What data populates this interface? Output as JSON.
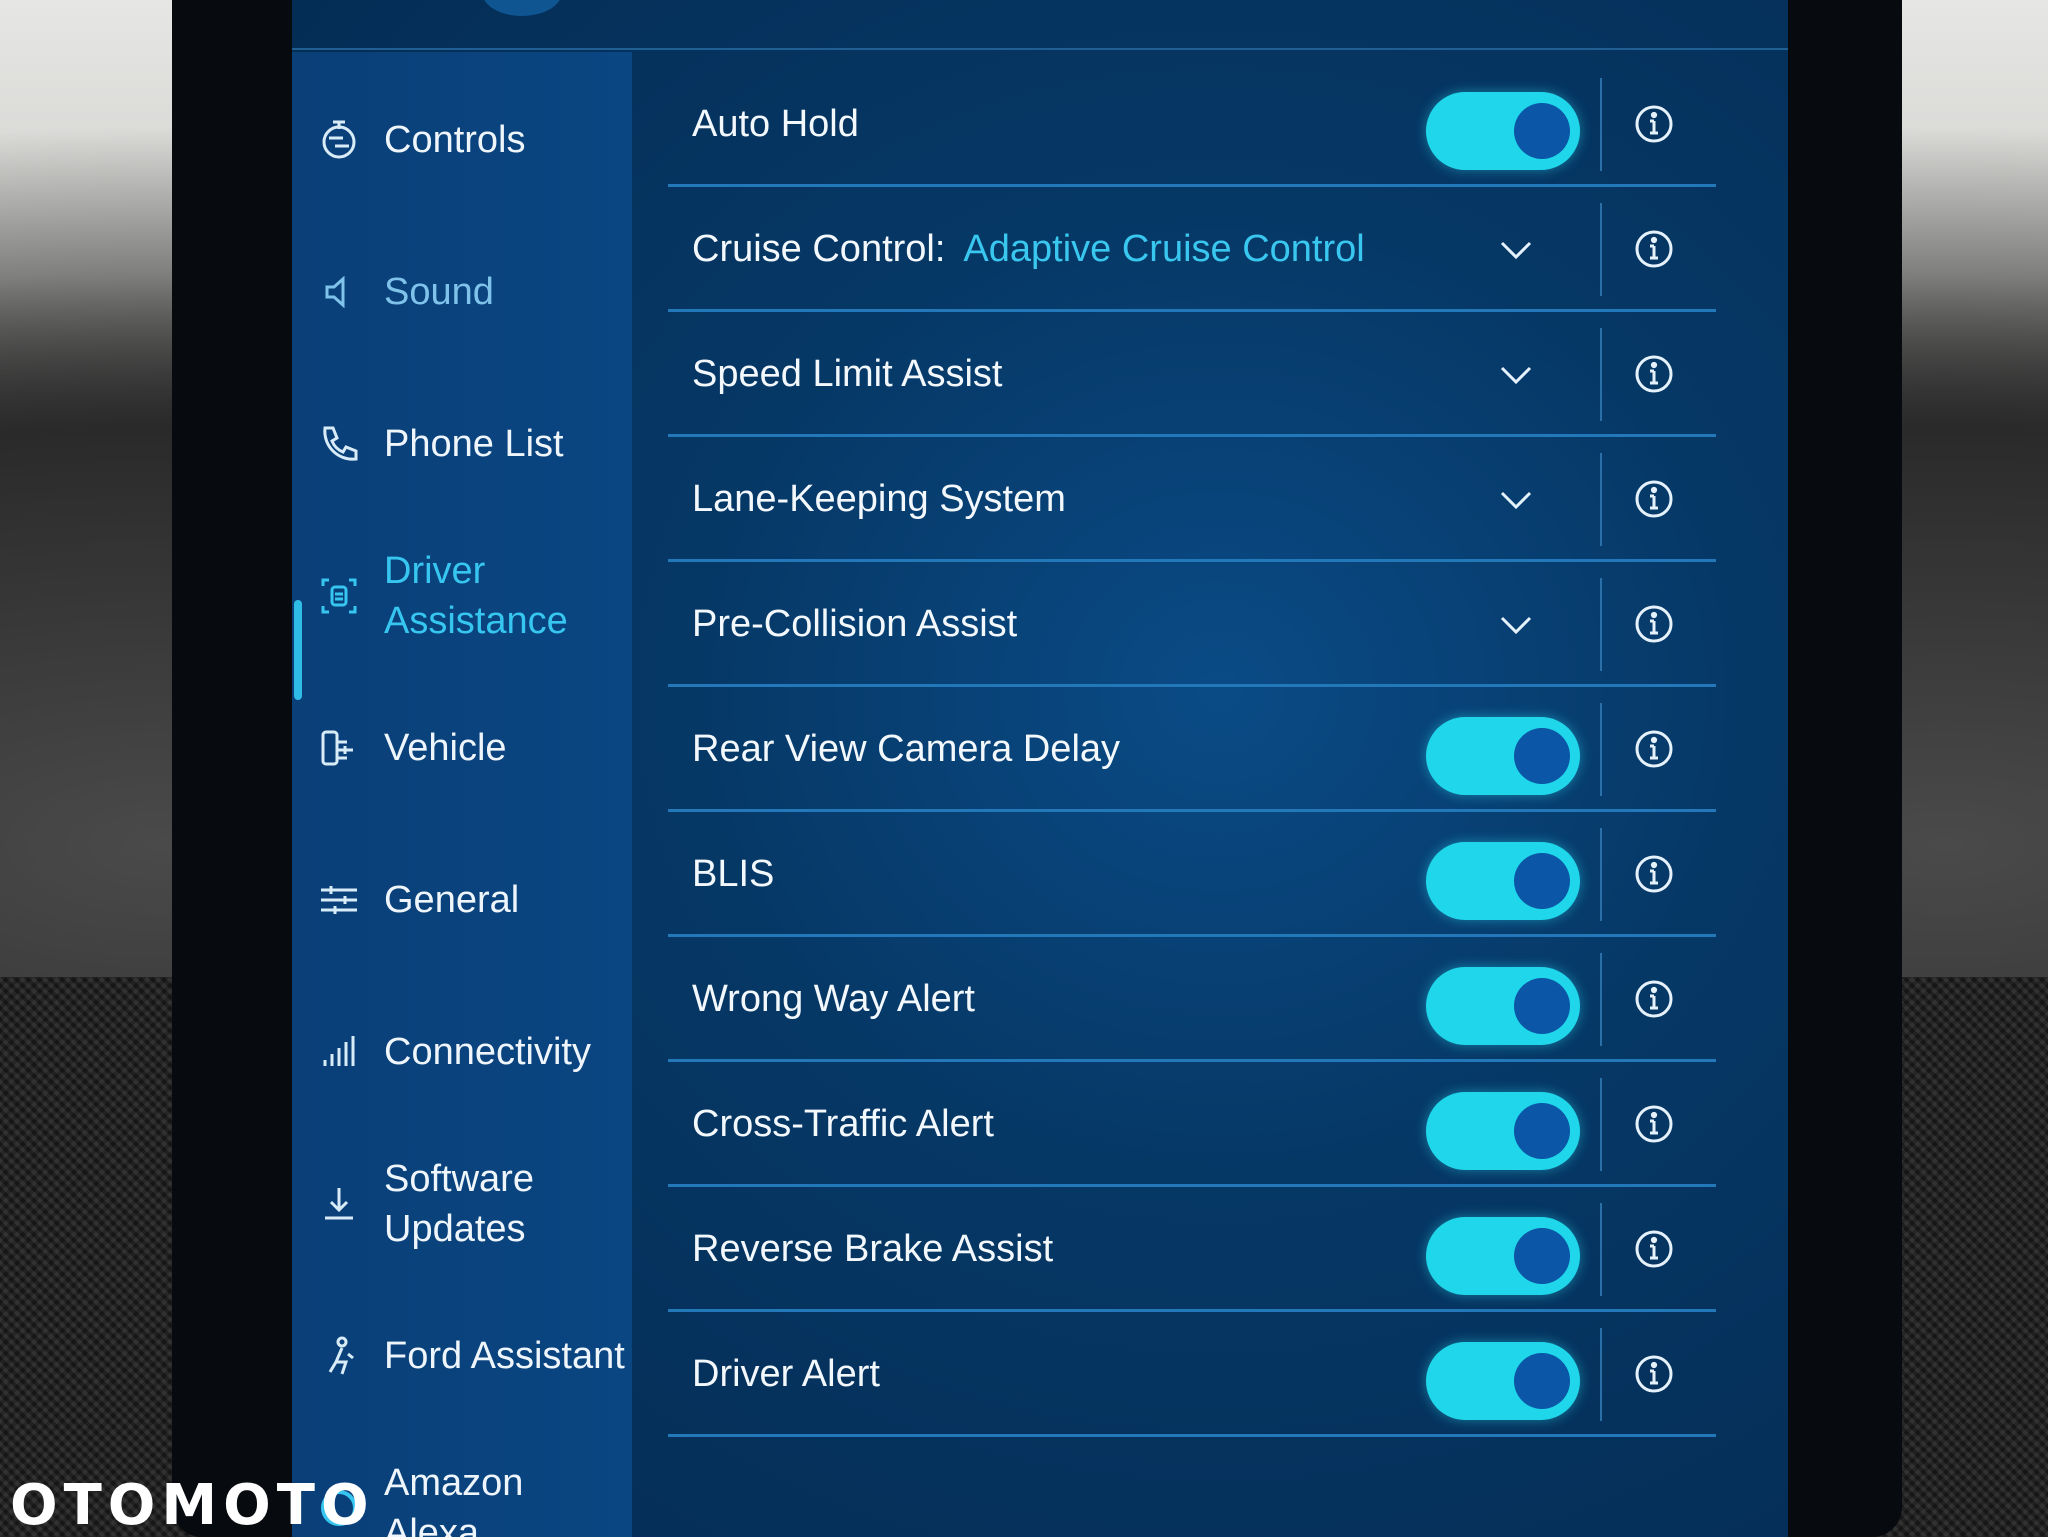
{
  "colors": {
    "screen_bg": "#063866",
    "accent": "#36c6f0",
    "toggle_on": "#1fd6ea",
    "knob": "#0b56a6",
    "divider": "#2278b8"
  },
  "sidebar": {
    "items": [
      {
        "label": "Controls",
        "icon": "controls-icon",
        "state": "normal"
      },
      {
        "label": "Sound",
        "icon": "speaker-icon",
        "state": "dim"
      },
      {
        "label": "Phone List",
        "icon": "phone-icon",
        "state": "normal"
      },
      {
        "label": "Driver Assistance",
        "icon": "driver-assist-icon",
        "state": "active"
      },
      {
        "label": "Vehicle",
        "icon": "vehicle-icon",
        "state": "normal"
      },
      {
        "label": "General",
        "icon": "sliders-icon",
        "state": "normal"
      },
      {
        "label": "Connectivity",
        "icon": "signal-bars-icon",
        "state": "normal"
      },
      {
        "label": "Software Updates",
        "icon": "download-icon",
        "state": "normal"
      },
      {
        "label": "Ford Assistant",
        "icon": "assistant-icon",
        "state": "normal"
      },
      {
        "label": "Amazon Alexa",
        "icon": "alexa-icon",
        "state": "normal"
      }
    ]
  },
  "settings": {
    "rows": [
      {
        "label": "Auto Hold",
        "control": "toggle",
        "on": true
      },
      {
        "label": "Cruise Control:",
        "value": "Adaptive Cruise Control",
        "control": "dropdown"
      },
      {
        "label": "Speed Limit Assist",
        "control": "dropdown"
      },
      {
        "label": "Lane-Keeping System",
        "control": "dropdown"
      },
      {
        "label": "Pre-Collision Assist",
        "control": "dropdown"
      },
      {
        "label": "Rear View Camera Delay",
        "control": "toggle",
        "on": true
      },
      {
        "label": "BLIS",
        "control": "toggle",
        "on": true
      },
      {
        "label": "Wrong Way Alert",
        "control": "toggle",
        "on": true
      },
      {
        "label": "Cross-Traffic Alert",
        "control": "toggle",
        "on": true
      },
      {
        "label": "Reverse Brake Assist",
        "control": "toggle",
        "on": true
      },
      {
        "label": "Driver Alert",
        "control": "toggle",
        "on": true
      }
    ]
  },
  "watermark": {
    "text": "OTOMOTO"
  }
}
